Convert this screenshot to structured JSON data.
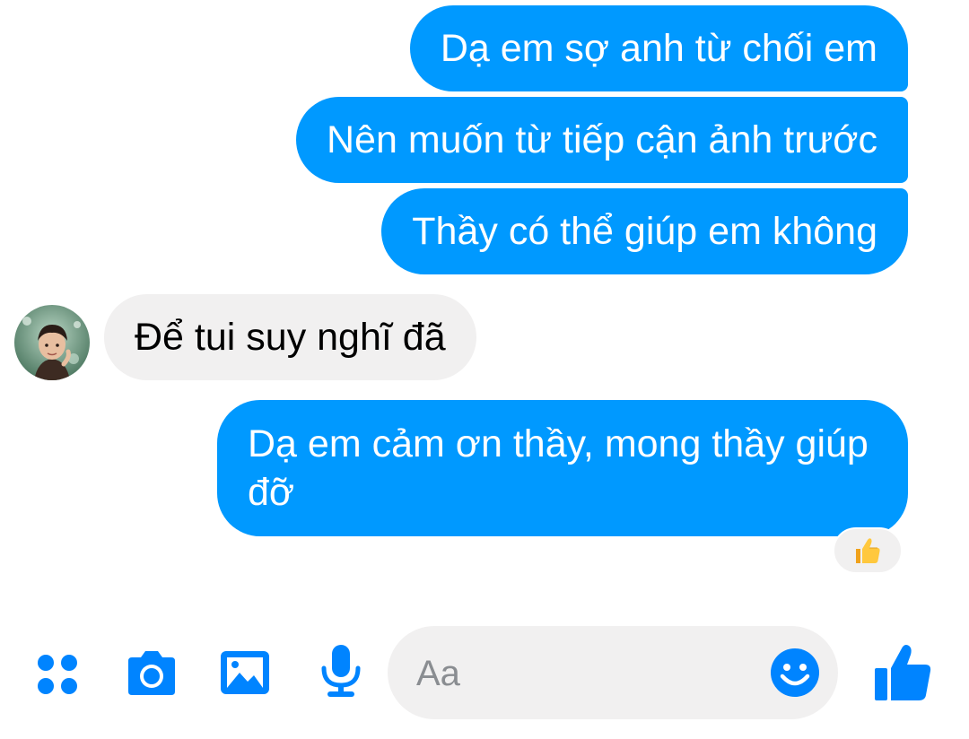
{
  "conversation": {
    "messages": [
      {
        "from": "me",
        "text": "Dạ em sợ anh từ chối em"
      },
      {
        "from": "me",
        "text": "Nên muốn từ tiếp cận ảnh trước"
      },
      {
        "from": "me",
        "text": "Thầy có thể giúp em không"
      },
      {
        "from": "them",
        "text": "Để tui suy nghĩ đã"
      },
      {
        "from": "me",
        "text": "Dạ em cảm ơn thầy, mong thầy giúp đỡ",
        "reaction": "thumbs-up-icon"
      }
    ]
  },
  "composer": {
    "placeholder": "Aa",
    "value": ""
  },
  "toolbar": {
    "icons": [
      "menu-dots-icon",
      "camera-icon",
      "gallery-icon",
      "microphone-icon",
      "emoji-icon",
      "like-icon"
    ]
  },
  "colors": {
    "outgoing_bubble": "#0099ff",
    "incoming_bubble": "#f1f0f0",
    "accent": "#0084ff"
  }
}
